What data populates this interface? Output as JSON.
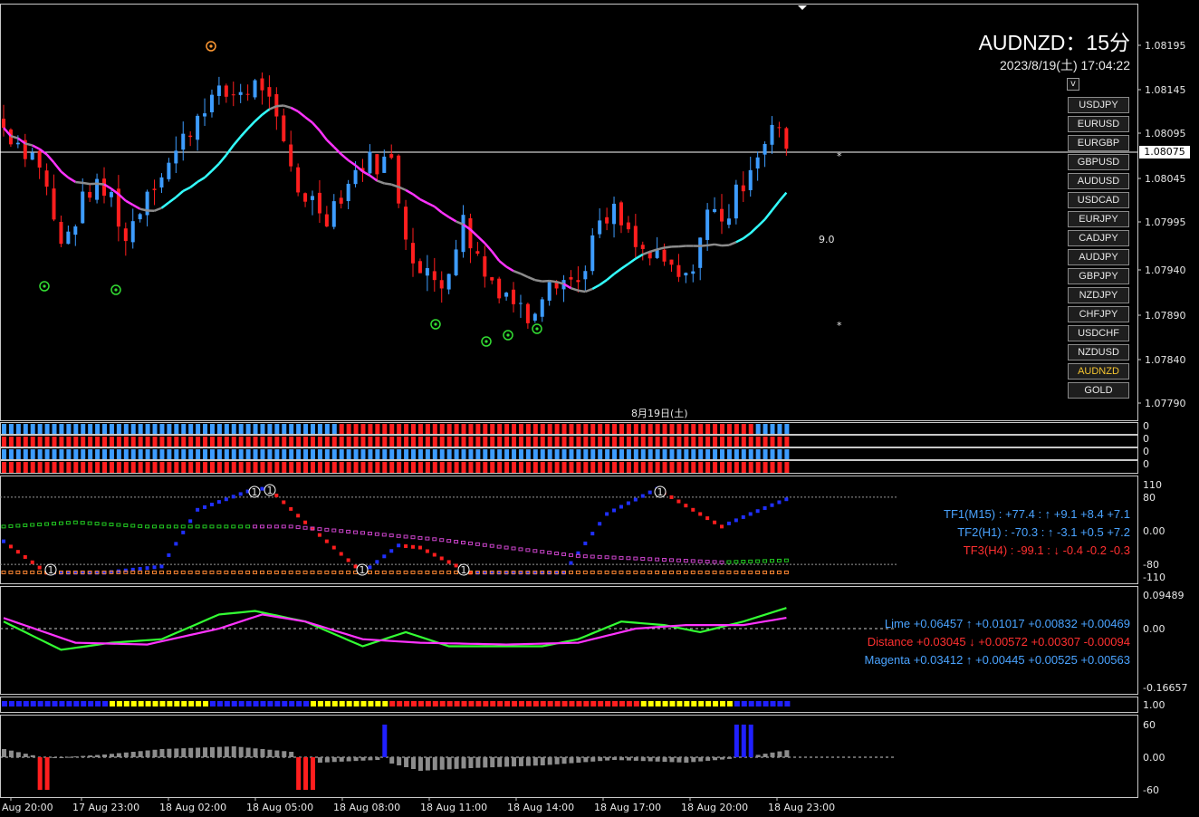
{
  "header": {
    "title": "AUDNZD：15分",
    "datetime": "2023/8/19(土) 17:04:22",
    "v_label": "v"
  },
  "symbols": [
    "USDJPY",
    "EURUSD",
    "EURGBP",
    "GBPUSD",
    "AUDUSD",
    "USDCAD",
    "EURJPY",
    "CADJPY",
    "AUDJPY",
    "GBPJPY",
    "NZDJPY",
    "CHFJPY",
    "USDCHF",
    "NZDUSD",
    "AUDNZD",
    "GOLD"
  ],
  "active_symbol": "AUDNZD",
  "price_axis": {
    "labels": [
      "1.08195",
      "1.08145",
      "1.08095",
      "1.08045",
      "1.07995",
      "1.07940",
      "1.07890",
      "1.07840",
      "1.07790"
    ],
    "current_price": "1.08075"
  },
  "markers": {
    "mid_value": "9.0",
    "star": "*"
  },
  "date_separator_label": "8月19日(土)",
  "oscillator1": {
    "axis": [
      "110",
      "80",
      "0.00",
      "-80",
      "-110"
    ],
    "lines": [
      {
        "text": "TF1(M15) : +77.4 : ↑  +9.1 +8.4 +7.1",
        "color": "#4aa3ff"
      },
      {
        "text": "TF2(H1) : -70.3 : ↑  -3.1 +0.5 +7.2",
        "color": "#4aa3ff"
      },
      {
        "text": "TF3(H4) : -99.1 : ↓  -0.4 -0.2 -0.3",
        "color": "#ff3030"
      }
    ]
  },
  "oscillator2": {
    "axis": [
      "0.09489",
      "0.00",
      "-0.16657"
    ],
    "lines": [
      {
        "text": "Lime +0.06457 ↑  +0.01017 +0.00832 +0.00469",
        "color": "#4aa3ff"
      },
      {
        "text": "Distance +0.03045 ↓  +0.00572 +0.00307 -0.00094",
        "color": "#ff3030"
      },
      {
        "text": "Magenta +0.03412 ↑  +0.00445 +0.00525 +0.00563",
        "color": "#4aa3ff"
      }
    ]
  },
  "strip_axis": "1.00",
  "histogram_axis": [
    "60",
    "0.00",
    "-60"
  ],
  "time_axis": [
    "Aug 20:00",
    "17 Aug 23:00",
    "18 Aug 02:00",
    "18 Aug 05:00",
    "18 Aug 08:00",
    "18 Aug 11:00",
    "18 Aug 14:00",
    "18 Aug 17:00",
    "18 Aug 20:00",
    "18 Aug 23:00"
  ],
  "colors": {
    "bull": "#3d9cff",
    "bear": "#ff1e1e",
    "ma_gray": "#8c8c8c",
    "ma_magenta": "#ff33ff",
    "ma_cyan": "#33ffff",
    "lime": "#33ff33",
    "yellow": "#ffff00"
  }
}
